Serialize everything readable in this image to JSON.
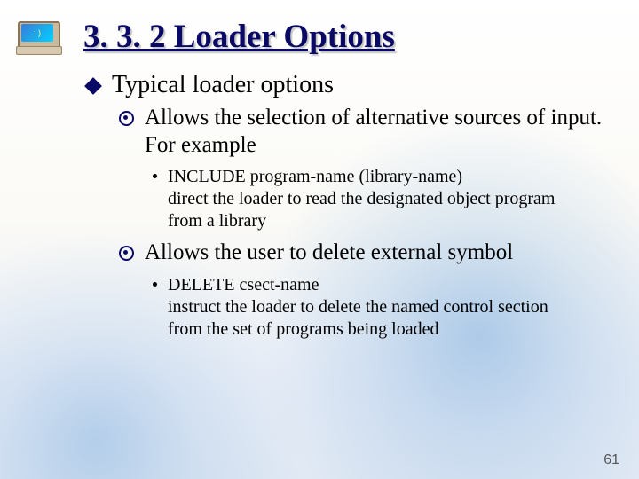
{
  "title": "3. 3. 2 Loader Options",
  "lvl1_text": "Typical loader options",
  "sub1_text": "Allows the selection of alternative sources of input. For example",
  "sub1_detail_line1": "INCLUDE  program-name (library-name)",
  "sub1_detail_line2": "direct the loader to read the designated object program from a library",
  "sub2_text": "Allows the user to delete external symbol",
  "sub2_detail_line1": "DELETE  csect-name",
  "sub2_detail_line2": "instruct the loader to delete the named control section from the set of programs being loaded",
  "computer_icon_face": ": )",
  "page_number": "61"
}
